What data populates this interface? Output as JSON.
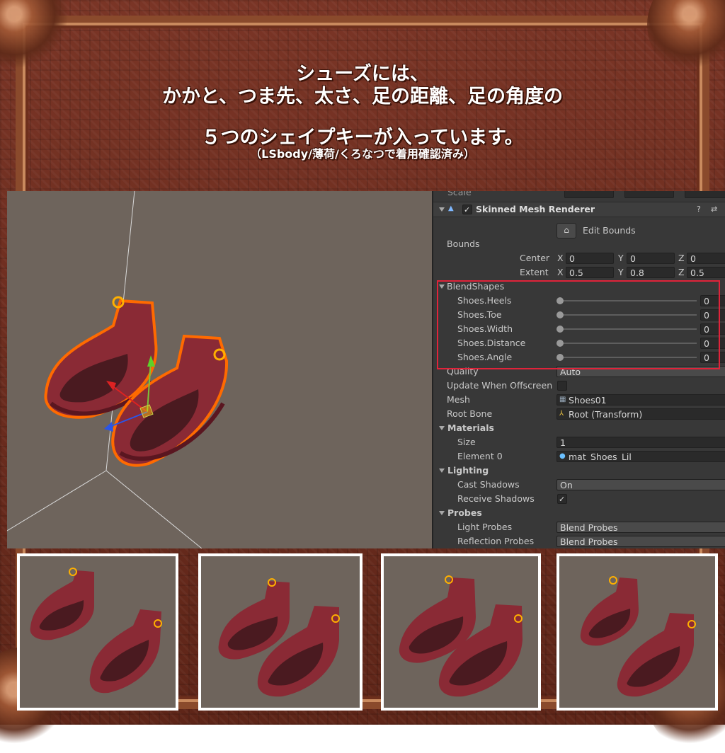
{
  "headline": {
    "line1": "シューズには、",
    "line2": "かかと、つま先、太さ、足の距離、足の角度の",
    "line3": "５つのシェイプキーが入っています。",
    "line4": "（LSbody/薄荷/くろなつで着用確認済み）"
  },
  "inspector": {
    "scale_label": "Scale",
    "component_title": "Skinned Mesh Renderer",
    "help_icon": "help-icon",
    "settings_icon": "settings-icon",
    "edit_bounds_label": "Edit Bounds",
    "bounds_label": "Bounds",
    "center_label": "Center",
    "extent_label": "Extent",
    "axis_x": "X",
    "axis_y": "Y",
    "axis_z": "Z",
    "center": {
      "x": "0",
      "y": "0",
      "z": "0"
    },
    "extent": {
      "x": "0.5",
      "y": "0.8",
      "z": "0.5"
    },
    "blendshapes_label": "BlendShapes",
    "blendshapes": [
      {
        "name": "Shoes.Heels",
        "value": "0"
      },
      {
        "name": "Shoes.Toe",
        "value": "0"
      },
      {
        "name": "Shoes.Width",
        "value": "0"
      },
      {
        "name": "Shoes.Distance",
        "value": "0"
      },
      {
        "name": "Shoes.Angle",
        "value": "0"
      }
    ],
    "quality_label": "Quality",
    "quality_value": "Auto",
    "update_offscreen_label": "Update When Offscreen",
    "mesh_label": "Mesh",
    "mesh_value": "Shoes01",
    "root_bone_label": "Root Bone",
    "root_bone_value": "Root (Transform)",
    "materials_label": "Materials",
    "size_label": "Size",
    "size_value": "1",
    "element0_label": "Element 0",
    "element0_value": "mat_Shoes_Lil",
    "lighting_label": "Lighting",
    "cast_shadows_label": "Cast Shadows",
    "cast_shadows_value": "On",
    "receive_shadows_label": "Receive Shadows",
    "probes_label": "Probes",
    "light_probes_label": "Light Probes",
    "light_probes_value": "Blend Probes",
    "reflection_probes_label": "Reflection Probes",
    "reflection_probes_value": "Blend Probes"
  },
  "colors": {
    "shoe": "#8a2a35",
    "shoe_dark": "#5a1620",
    "outline": "#ff6a00",
    "highlight_box": "#e0233a",
    "viewport_bg": "#6e645c",
    "inspector_bg": "#383838"
  }
}
